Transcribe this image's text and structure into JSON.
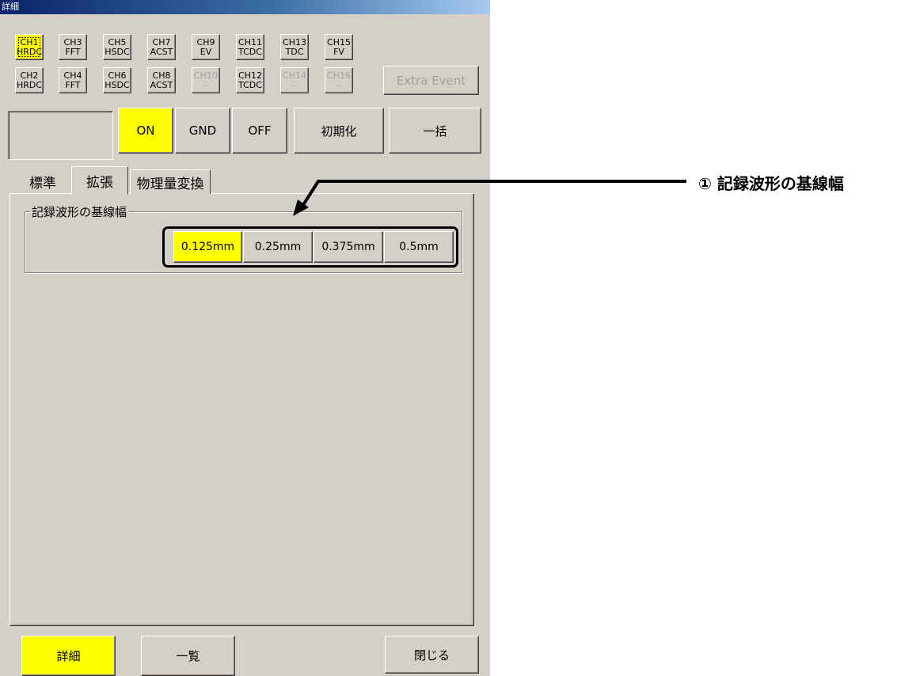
{
  "window": {
    "title": "詳細"
  },
  "channels": {
    "row1": [
      {
        "ch": "CH1",
        "mode": "HRDC"
      },
      {
        "ch": "CH3",
        "mode": "FFT"
      },
      {
        "ch": "CH5",
        "mode": "HSDC"
      },
      {
        "ch": "CH7",
        "mode": "ACST"
      },
      {
        "ch": "CH9",
        "mode": "EV"
      },
      {
        "ch": "CH11",
        "mode": "TCDC"
      },
      {
        "ch": "CH13",
        "mode": "TDC"
      },
      {
        "ch": "CH15",
        "mode": "FV"
      }
    ],
    "row2": [
      {
        "ch": "CH2",
        "mode": "HRDC"
      },
      {
        "ch": "CH4",
        "mode": "FFT"
      },
      {
        "ch": "CH6",
        "mode": "HSDC"
      },
      {
        "ch": "CH8",
        "mode": "ACST"
      },
      {
        "ch": "CH10",
        "mode": "--"
      },
      {
        "ch": "CH12",
        "mode": "TCDC"
      },
      {
        "ch": "CH14",
        "mode": "--"
      },
      {
        "ch": "CH16",
        "mode": "--"
      }
    ],
    "selected": "CH1",
    "disabled": [
      "CH10",
      "CH14",
      "CH16"
    ]
  },
  "extra_event_label": "Extra Event",
  "controls": {
    "on": "ON",
    "gnd": "GND",
    "off": "OFF",
    "init": "初期化",
    "bulk": "一括"
  },
  "tabs": {
    "standard": "標準",
    "extended": "拡張",
    "physical": "物理量変換",
    "active": "拡張"
  },
  "line_width": {
    "group_label": "記録波形の基線幅",
    "options": [
      "0.125mm",
      "0.25mm",
      "0.375mm",
      "0.5mm"
    ],
    "selected": "0.125mm"
  },
  "footer": {
    "detail": "詳細",
    "list": "一覧",
    "close": "閉じる"
  },
  "annotation": {
    "label": "① 記録波形の基線幅"
  },
  "colors": {
    "active": "#ffff00",
    "face": "#d4d0c8"
  }
}
